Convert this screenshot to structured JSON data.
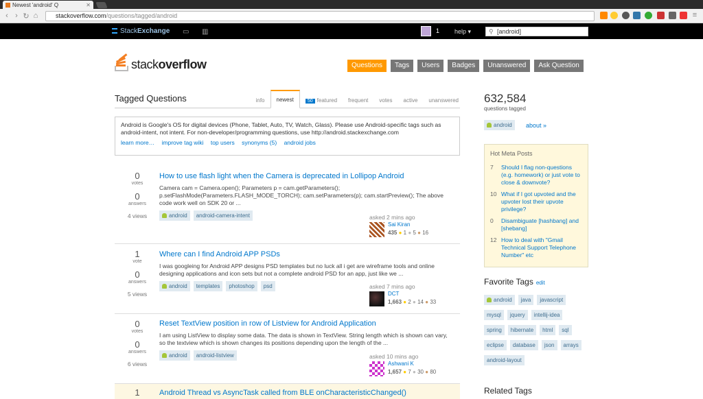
{
  "browser": {
    "tab_title": "Newest 'android' Q",
    "url_domain": "stackoverflow.com",
    "url_path": "/questions/tagged/android"
  },
  "topbar": {
    "network_name": "Stack",
    "network_name_bold": "Exchange",
    "rep": "1",
    "help": "help ▾",
    "search_value": "[android]"
  },
  "site": {
    "logo_text_light": "stack",
    "logo_text_bold": "overflow",
    "nav": [
      "Questions",
      "Tags",
      "Users",
      "Badges",
      "Unanswered",
      "Ask Question"
    ]
  },
  "subheader": {
    "title": "Tagged Questions",
    "tabs": [
      {
        "label": "info"
      },
      {
        "label": "newest"
      },
      {
        "label": "featured",
        "badge": "50"
      },
      {
        "label": "frequent"
      },
      {
        "label": "votes"
      },
      {
        "label": "active"
      },
      {
        "label": "unanswered"
      }
    ]
  },
  "wiki": {
    "text": "Android is Google's OS for digital devices (Phone, Tablet, Auto, TV, Watch, Glass). Please use Android-specific tags such as android-intent, not intent. For non-developer/programming questions, use http://android.stackexchange.com",
    "links": [
      "learn more…",
      "improve tag wiki",
      "top users",
      "synonyms (5)",
      "android jobs"
    ]
  },
  "questions": [
    {
      "votes": "0",
      "votes_label": "votes",
      "answers": "0",
      "answers_label": "answers",
      "views": "4 views",
      "title": "How to use flash light when the Camera is deprecated in Lollipop Android",
      "excerpt": "Camera cam = Camera.open(); Parameters p = cam.getParameters(); p.setFlashMode(Parameters.FLASH_MODE_TORCH); cam.setParameters(p); cam.startPreview(); The above code work well on SDK 20 or ...",
      "tags": [
        "android",
        "android-camera-intent"
      ],
      "asked": "asked 2 mins ago",
      "user": "Sai Kiran",
      "rep": "435",
      "gold": "1",
      "silver": "5",
      "bronze": "16"
    },
    {
      "votes": "1",
      "votes_label": "vote",
      "answers": "0",
      "answers_label": "answers",
      "views": "5 views",
      "title": "Where can I find Android APP PSDs",
      "excerpt": "I was googleing for Android APP designs PSD templates but no luck all i get are wireframe tools and online designing applications and icon sets but not a complete android PSD for an app, just like we ...",
      "tags": [
        "android",
        "templates",
        "photoshop",
        "psd"
      ],
      "asked": "asked 7 mins ago",
      "user": "DCT",
      "rep": "1,663",
      "gold": "2",
      "silver": "14",
      "bronze": "33"
    },
    {
      "votes": "0",
      "votes_label": "votes",
      "answers": "0",
      "answers_label": "answers",
      "views": "6 views",
      "title": "Reset TextView position in row of Listview for Android Application",
      "excerpt": "I am using ListView to display some data. The data is shown in TextView. String length which is shown can vary, so the textview which is shown changes its positions depending upon the length of the ...",
      "tags": [
        "android",
        "android-listview"
      ],
      "asked": "asked 10 mins ago",
      "user": "Ashwani K",
      "rep": "1,657",
      "gold": "7",
      "silver": "30",
      "bronze": "80"
    },
    {
      "votes": "1",
      "title": "Android Thread vs AsyncTask called from BLE onCharacteristicChanged()"
    }
  ],
  "sidebar": {
    "count": "632,584",
    "count_label": "questions tagged",
    "tag": "android",
    "about": "about »",
    "meta_title": "Hot Meta Posts",
    "meta_posts": [
      {
        "n": "7",
        "title": "Should I flag non-questions (e.g. homework) or just vote to close & downvote?"
      },
      {
        "n": "10",
        "title": "What if I got upvoted and the upvoter lost their upvote privilege?"
      },
      {
        "n": "0",
        "title": "Disambiguate [hashbang] and [shebang]"
      },
      {
        "n": "12",
        "title": "How to deal with \"Gmail Technical Support Telephone Number\" etc"
      }
    ],
    "favorite_title": "Favorite Tags",
    "favorite_edit": "edit",
    "favorite_tags": [
      "android",
      "java",
      "javascript",
      "mysql",
      "jquery",
      "intellij-idea",
      "spring",
      "hibernate",
      "html",
      "sql",
      "eclipse",
      "database",
      "json",
      "arrays",
      "android-layout"
    ],
    "related_title": "Related Tags"
  },
  "colors": {
    "accent": "#ff9900",
    "link": "#0077cc",
    "tag_bg": "#e0eaf1",
    "meta_bg": "#fff8dc"
  }
}
